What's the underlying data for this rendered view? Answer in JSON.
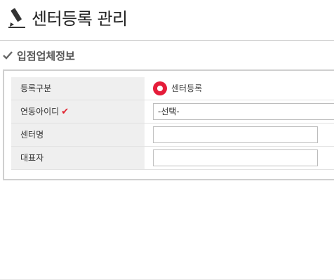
{
  "header": {
    "icon": "pencil-icon",
    "title": "센터등록 관리"
  },
  "section": {
    "icon": "check-icon",
    "title": "입점업체정보"
  },
  "form": {
    "rows": [
      {
        "label": "등록구분",
        "type": "radio",
        "option_label": "센터등록",
        "selected": true
      },
      {
        "label": "연동아이디",
        "required": true,
        "required_mark": "✔",
        "type": "select",
        "value": "-선택-"
      },
      {
        "label": "센터명",
        "type": "text",
        "value": ""
      },
      {
        "label": "대표자",
        "type": "text",
        "value": ""
      }
    ]
  },
  "colors": {
    "accent": "#e51d3a",
    "required_mark": "#e0202c",
    "label_bg": "#efefef",
    "border": "#cfcfcf"
  }
}
